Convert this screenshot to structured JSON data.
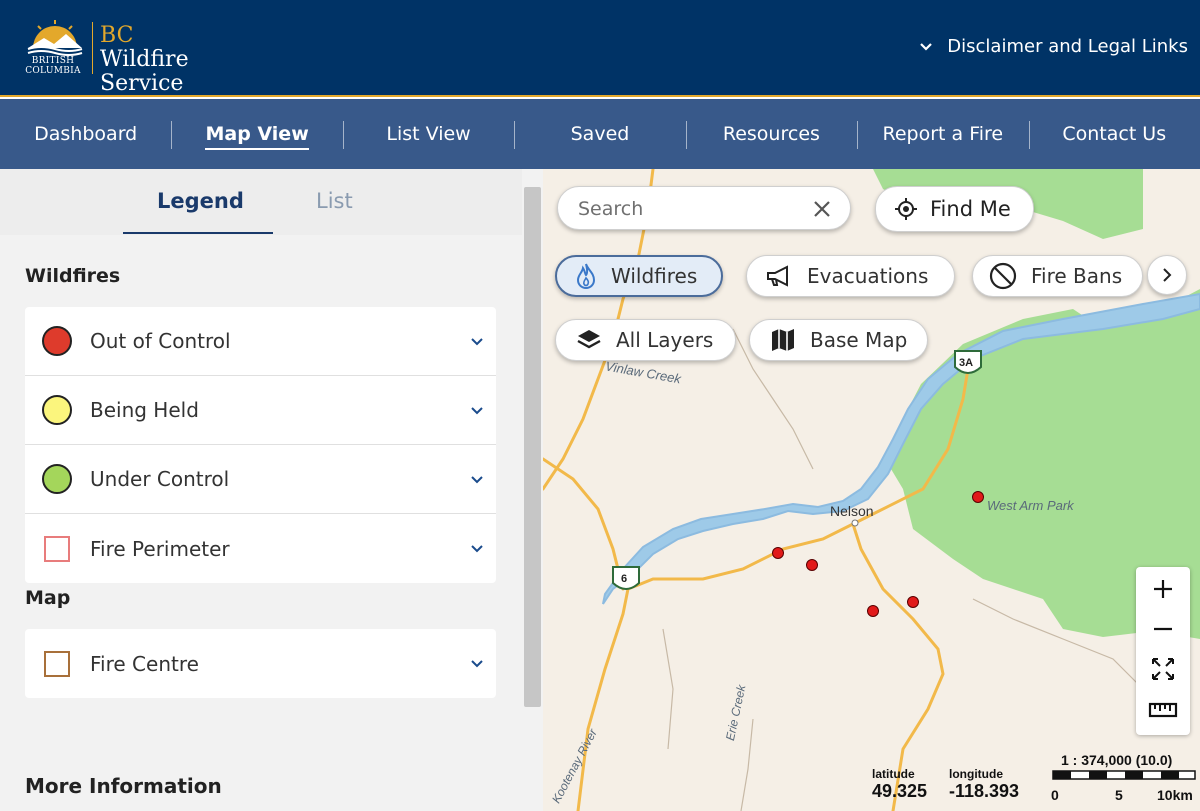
{
  "header": {
    "logo_province": "BRITISH\nCOLUMBIA",
    "logo_title_bc": "BC",
    "logo_title_rest": " Wildfire",
    "logo_title_line2": "Service",
    "disclaimer": "Disclaimer and Legal Links"
  },
  "nav": {
    "items": [
      {
        "label": "Dashboard"
      },
      {
        "label": "Map View",
        "active": true
      },
      {
        "label": "List View"
      },
      {
        "label": "Saved"
      },
      {
        "label": "Resources"
      },
      {
        "label": "Report a Fire"
      },
      {
        "label": "Contact Us"
      }
    ]
  },
  "sidebar": {
    "tabs": [
      {
        "label": "Legend",
        "active": true
      },
      {
        "label": "List"
      }
    ],
    "wildfires_title": "Wildfires",
    "wildfires": [
      {
        "label": "Out of Control",
        "color": "#de3b2c"
      },
      {
        "label": "Being Held",
        "color": "#fbf57d"
      },
      {
        "label": "Under Control",
        "color": "#a4d65b"
      },
      {
        "label": "Fire Perimeter",
        "color": "#e87c7c"
      }
    ],
    "map_title": "Map",
    "map_items": [
      {
        "label": "Fire Centre",
        "color": "#a8703a"
      }
    ],
    "more_info_title": "More Information"
  },
  "map": {
    "search_placeholder": "Search",
    "find_me": "Find Me",
    "layers": [
      {
        "label": "Wildfires",
        "icon": "flame-icon",
        "selected": true
      },
      {
        "label": "Evacuations",
        "icon": "megaphone-icon"
      },
      {
        "label": "Fire Bans",
        "icon": "ban-icon"
      }
    ],
    "all_layers": "All Layers",
    "base_map": "Base Map",
    "place_labels": {
      "nelson": "Nelson",
      "west_arm_park": "West Arm Park",
      "creek_top": "Vinlaw Creek",
      "erie_creek": "Erie Creek",
      "kootenay_river": "Kootenay River"
    },
    "highway_shields": [
      "3A",
      "6"
    ],
    "coords": {
      "lat_label": "latitude",
      "lat_value": "49.325",
      "lon_label": "longitude",
      "lon_value": "-118.393"
    },
    "scale": {
      "ratio": "1 : 374,000 (10.0)",
      "ticks": [
        "0",
        "5",
        "10km"
      ]
    },
    "colors": {
      "land": "#f5efe6",
      "park": "#a6dd94",
      "water": "#9ecae8",
      "road": "#f2b94a",
      "fire": "#e11a1a"
    }
  }
}
